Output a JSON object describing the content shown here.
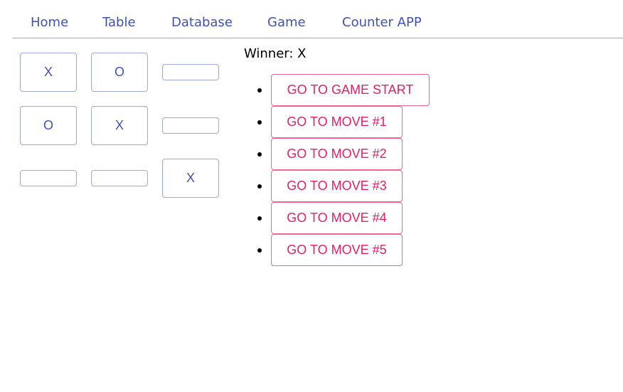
{
  "nav": {
    "home": "Home",
    "table": "Table",
    "database": "Database",
    "game": "Game",
    "counter": "Counter APP"
  },
  "board": {
    "squares": [
      "X",
      "O",
      "",
      "O",
      "X",
      "",
      "",
      "",
      "X"
    ]
  },
  "status": {
    "text": "Winner: X"
  },
  "moves": [
    "GO TO GAME START",
    "GO TO MOVE #1",
    "GO TO MOVE #2",
    "GO TO MOVE #3",
    "GO TO MOVE #4",
    "GO TO MOVE #5"
  ],
  "colors": {
    "nav_text": "#3f51b5",
    "square_border": "#9fa8da",
    "move_border": "#f06292",
    "move_text": "#e91e63"
  }
}
